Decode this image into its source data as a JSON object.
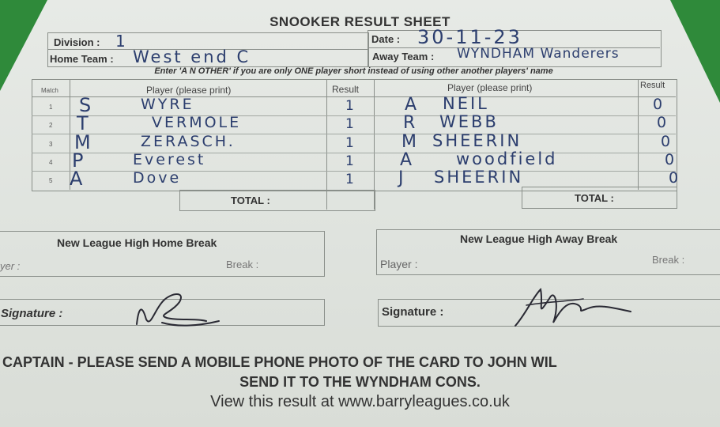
{
  "sheet": {
    "title": "SNOOKER RESULT SHEET",
    "division_label": "Division :",
    "division_value": "1",
    "date_label": "Date :",
    "date_value": "30-11-23",
    "home_label": "Home Team :",
    "home_value": "West end C",
    "away_label": "Away Team :",
    "away_value": "WYNDHAM Wanderers",
    "instruction": "Enter 'A N OTHER' if you are only ONE player short instead of using other another players' name"
  },
  "table": {
    "match_header": "Match",
    "player_header": "Player (please print)",
    "result_header": "Result",
    "away_player_header": "Player (please print)",
    "away_result_header": "Result",
    "total_label": "TOTAL :",
    "away_total_label": "TOTAL :",
    "rows": [
      {
        "match": "1",
        "home_initial": "S",
        "home_name": "WYRE",
        "home_result": "1",
        "away_initial": "A",
        "away_name": "NEIL",
        "away_result": "0"
      },
      {
        "match": "2",
        "home_initial": "T",
        "home_name": "VERMOLE",
        "home_result": "1",
        "away_initial": "R",
        "away_name": "WEBB",
        "away_result": "0"
      },
      {
        "match": "3",
        "home_initial": "M",
        "home_name": "ZERASCH.",
        "home_result": "1",
        "away_initial": "M",
        "away_name": "SHEERIN",
        "away_result": "0"
      },
      {
        "match": "4",
        "home_initial": "P",
        "home_name": "Everest",
        "home_result": "1",
        "away_initial": "A",
        "away_name": "woodfield",
        "away_result": "0"
      },
      {
        "match": "5",
        "home_initial": "A",
        "home_name": "Dove",
        "home_result": "1",
        "away_initial": "J",
        "away_name": "SHEERIN",
        "away_result": "0"
      }
    ]
  },
  "breaks": {
    "home_title": "New League High Home Break",
    "away_title": "New League High Away Break",
    "home_player_label": "yer :",
    "away_player_label": "Player :",
    "home_break_label": "Break :",
    "away_break_label": "Break :"
  },
  "signatures": {
    "home_label": "Signature :",
    "away_label": "Signature :"
  },
  "footer": {
    "line1": "CAPTAIN - PLEASE SEND A MOBILE PHONE PHOTO OF THE CARD TO JOHN WIL",
    "line2": "SEND IT TO THE WYNDHAM CONS.",
    "line3": "View this result at www.barryleagues.co.uk"
  }
}
